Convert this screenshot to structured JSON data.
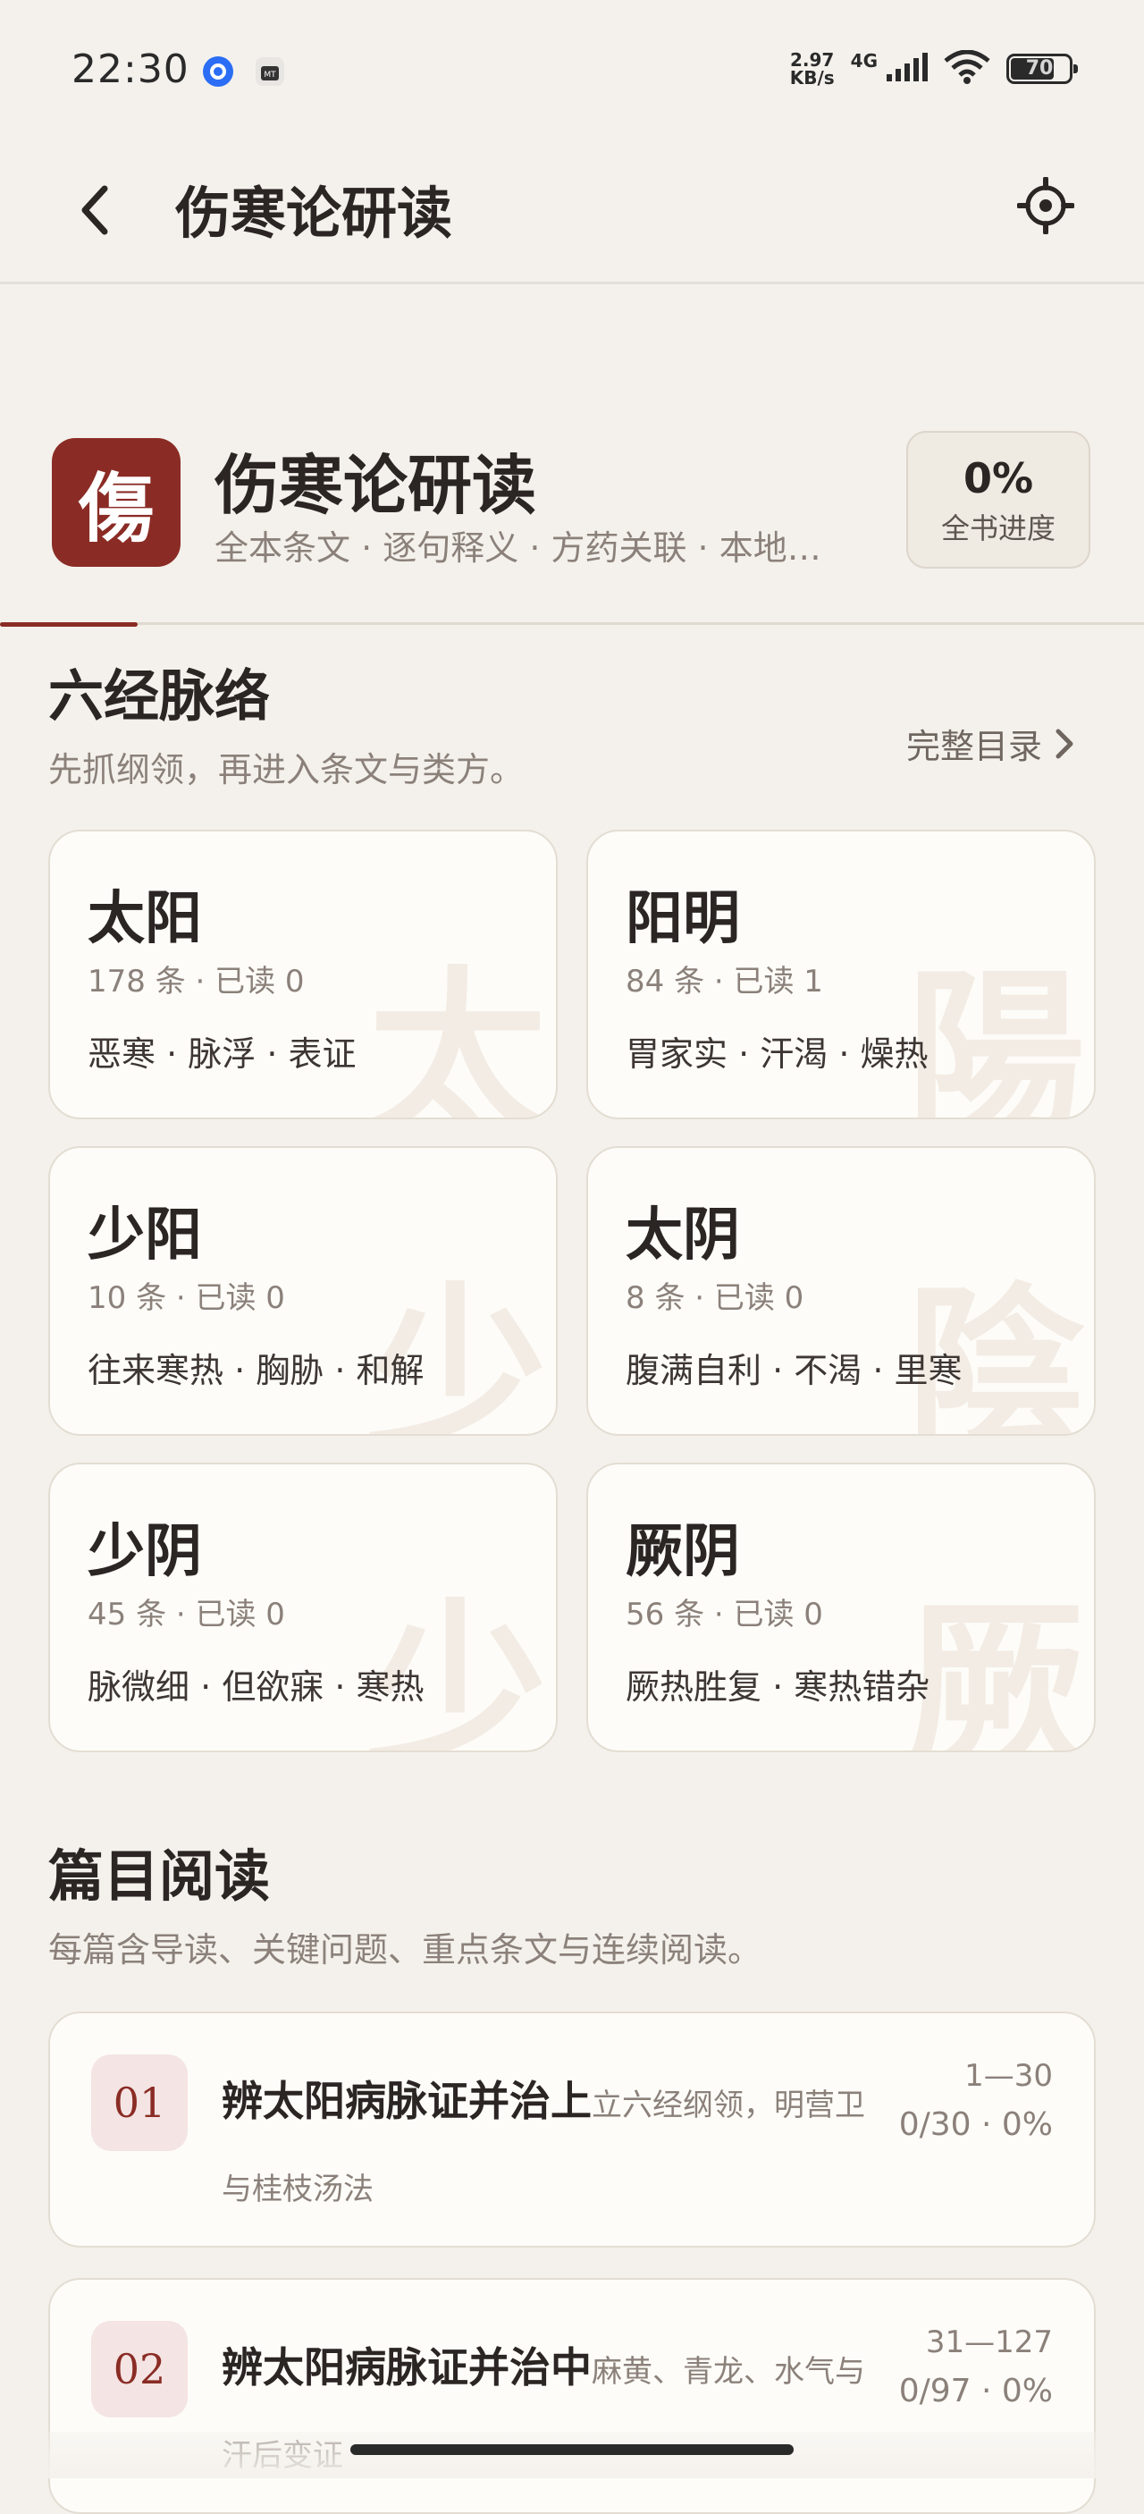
{
  "status_bar": {
    "time": "22:30",
    "net_speed_value": "2.97",
    "net_speed_unit": "KB/s",
    "net_type": "4G",
    "battery": "70",
    "battery_fraction": 0.7
  },
  "app_bar": {
    "title": "伤寒论研读"
  },
  "hero": {
    "logo_char": "傷",
    "title": "伤寒论研读",
    "subtitle": "全本条文 · 逐句释义 · 方药关联 · 本地…",
    "progress_value": "0%",
    "progress_label": "全书进度",
    "progress_fraction": 0.12
  },
  "meridians": {
    "title": "六经脉络",
    "description": "先抓纲领，再进入条文与类方。",
    "toc_label": "完整目录",
    "items": [
      {
        "name": "太阳",
        "meta": "178 条 · 已读 0",
        "keys": "恶寒 · 脉浮 · 表证",
        "bg_char": "太"
      },
      {
        "name": "阳明",
        "meta": "84 条 · 已读 1",
        "keys": "胃家实 · 汗渴 · 燥热",
        "bg_char": "陽"
      },
      {
        "name": "少阳",
        "meta": "10 条 · 已读 0",
        "keys": "往来寒热 · 胸胁 · 和解",
        "bg_char": "少"
      },
      {
        "name": "太阴",
        "meta": "8 条 · 已读 0",
        "keys": "腹满自利 · 不渴 · 里寒",
        "bg_char": "陰"
      },
      {
        "name": "少阴",
        "meta": "45 条 · 已读 0",
        "keys": "脉微细 · 但欲寐 · 寒热",
        "bg_char": "少"
      },
      {
        "name": "厥阴",
        "meta": "56 条 · 已读 0",
        "keys": "厥热胜复 · 寒热错杂",
        "bg_char": "厥"
      }
    ]
  },
  "chapters": {
    "title": "篇目阅读",
    "description": "每篇含导读、关键问题、重点条文与连续阅读。",
    "items": [
      {
        "num": "01",
        "title": "辨太阳病脉证并治上",
        "subtitle": "立六经纲领，明营卫与桂枝汤法",
        "range": "1—30",
        "progress": "0/30 · 0%"
      },
      {
        "num": "02",
        "title": "辨太阳病脉证并治中",
        "subtitle": "麻黄、青龙、水气与汗后变证",
        "range": "31—127",
        "progress": "0/97 · 0%"
      }
    ]
  },
  "colors": {
    "accent": "#8a2c25",
    "background": "#f4f1ec",
    "card": "#fdfcf8"
  }
}
